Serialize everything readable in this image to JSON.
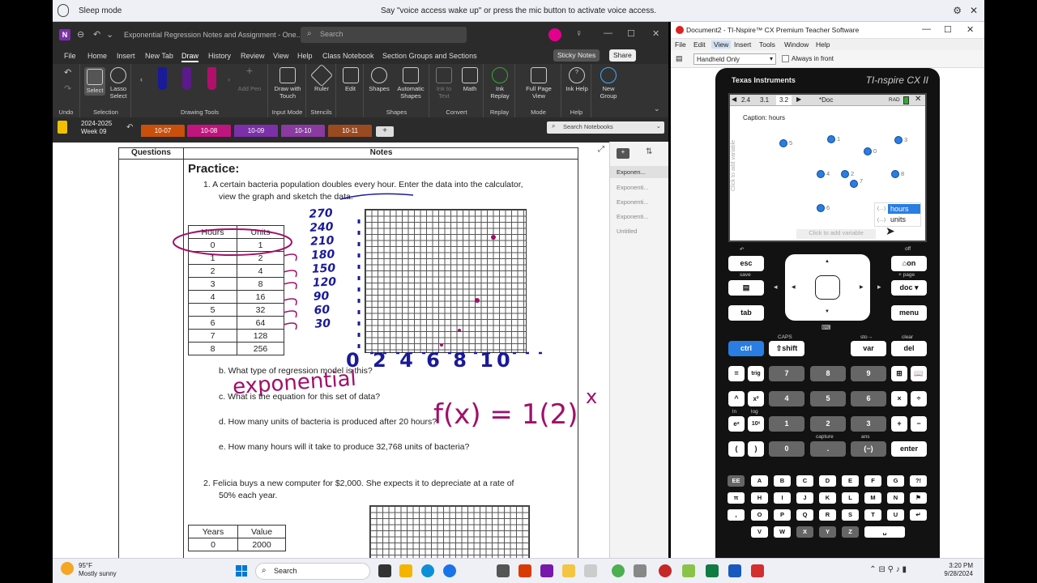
{
  "voice_bar": {
    "status": "Sleep mode",
    "message": "Say \"voice access wake up\" or press the mic button to activate voice access."
  },
  "onenote": {
    "window_title": "Exponential Regression Notes and Assignment  -  One...",
    "search_placeholder": "Search",
    "menu": [
      "File",
      "Home",
      "Insert",
      "New Tab",
      "Draw",
      "History",
      "Review",
      "View",
      "Help",
      "Class Notebook",
      "Section Groups and Sections"
    ],
    "active_menu": "Draw",
    "sticky_notes": "Sticky Notes",
    "share": "Share",
    "ribbon": {
      "undo_group": "Undo",
      "select": "Select",
      "lasso": "Lasso Select",
      "selection_group": "Selection",
      "add_pen": "Add Pen",
      "drawing_tools": "Drawing Tools",
      "draw_with_touch": "Draw with Touch",
      "input_mode": "Input Mode",
      "ruler": "Ruler",
      "stencils": "Stencils",
      "edit": "Edit",
      "shapes": "Shapes",
      "automatic_shapes": "Automatic Shapes",
      "shapes_group": "Shapes",
      "ink_to_text": "Ink to Text",
      "math": "Math",
      "convert_group": "Convert",
      "ink_replay": "Ink Replay",
      "replay_group": "Replay",
      "full_page_view": "Full Page View",
      "mode_group": "Mode",
      "ink_help": "Ink Help",
      "help_group": "Help",
      "new_group": "New Group"
    },
    "notebook": {
      "name": "2024-2025",
      "week": "Week 09"
    },
    "section_tabs": [
      {
        "label": "10-07",
        "color": "#c8500a",
        "text": "#fff"
      },
      {
        "label": "10-08",
        "color": "#c0157e",
        "text": "#fff"
      },
      {
        "label": "10-09",
        "color": "#7b2fa8",
        "text": "#fff"
      },
      {
        "label": "10-10",
        "color": "#8a3aa0",
        "text": "#fff"
      },
      {
        "label": "10-11",
        "color": "#9a4a20",
        "text": "#fff"
      }
    ],
    "search_notebooks": "Search Notebooks",
    "pages": [
      "Exponen...",
      "Exponenti...",
      "Exponenti...",
      "Exponenti...",
      "Untitled"
    ],
    "page": {
      "col_questions": "Questions",
      "col_notes": "Notes",
      "heading": "Practice:",
      "q1_line1": "1.    A certain bacteria population doubles every hour.  Enter the data into the calculator,",
      "q1_line2": "view the graph and sketch the data.",
      "table1_headers": [
        "Hours",
        "Units"
      ],
      "table1_rows": [
        [
          "0",
          "1"
        ],
        [
          "1",
          "2"
        ],
        [
          "2",
          "4"
        ],
        [
          "3",
          "8"
        ],
        [
          "4",
          "16"
        ],
        [
          "5",
          "32"
        ],
        [
          "6",
          "64"
        ],
        [
          "7",
          "128"
        ],
        [
          "8",
          "256"
        ]
      ],
      "qb": "b.   What type of regression model is this?",
      "qc": "c.   What is the equation for this set of data?",
      "qd": "d.   How many units of bacteria is produced after 20 hours?",
      "qe": "e.   How many hours will it take to produce 32,768 units of bacteria?",
      "q2_line1": "2.    Felicia buys a new computer for $2,000.  She expects it to depreciate at a rate of",
      "q2_line2": "50% each year.",
      "table2_headers": [
        "Years",
        "Value"
      ],
      "table2_rows": [
        [
          "0",
          "2000"
        ]
      ],
      "ink_answer": "exponential",
      "ink_equation": "f(x) = 1(2)",
      "ink_exponent": "x",
      "ink_y_labels": [
        "270",
        "240",
        "210",
        "180",
        "150",
        "120",
        "90",
        "60",
        "30"
      ],
      "ink_x_labels": "0  2  4  6  8  10"
    }
  },
  "nspire": {
    "window_title": "Document2 - TI-Nspire™ CX Premium Teacher Software",
    "menu": [
      "File",
      "Edit",
      "View",
      "Insert",
      "Tools",
      "Window",
      "Help"
    ],
    "view_mode": "Handheld Only",
    "always_in_front": "Always in front",
    "brand": "Texas Instruments",
    "model": "TI-nspire CX II",
    "tabs": [
      "2.4",
      "3.1",
      "3.2"
    ],
    "doc_label": "*Doc",
    "rad": "RAD",
    "caption": "Caption: hours",
    "add_variable_v": "Click to add variable",
    "add_variable_h": "Click to add variable",
    "var_options": [
      "hours",
      "units"
    ],
    "point_labels": [
      "5",
      "1",
      "0",
      "3",
      "4",
      "2",
      "7",
      "8",
      "6"
    ],
    "keys": {
      "esc": "esc",
      "on": "on",
      "save": "save",
      "off": "off",
      "page": "+ page",
      "doc": "doc",
      "tab": "tab",
      "menu": "menu",
      "caps": "CAPS",
      "sto": "sto→",
      "clear": "clear",
      "ctrl": "ctrl",
      "shift": "shift",
      "var": "var",
      "del": "del",
      "num": [
        "7",
        "8",
        "9",
        "4",
        "5",
        "6",
        "1",
        "2",
        "3",
        "0",
        ".",
        "(−)"
      ],
      "enter": "enter",
      "ex": "eˣ",
      "tenx": "10ˣ",
      "ln": "ln",
      "log": "log",
      "x2": "x²",
      "trig": "trig",
      "capture": "capture",
      "ans": "ans",
      "alpha1": [
        "EE",
        "A",
        "B",
        "C",
        "D",
        "E",
        "F",
        "G",
        "?!"
      ],
      "alpha2": [
        "π",
        "H",
        "I",
        "J",
        "K",
        "L",
        "M",
        "N",
        ""
      ],
      "alpha3": [
        ",",
        "O",
        "P",
        "Q",
        "R",
        "S",
        "T",
        "U",
        "↵"
      ],
      "alpha4": [
        "V",
        "W",
        "X",
        "Y",
        "Z",
        "␣"
      ]
    }
  },
  "taskbar": {
    "temperature": "95°F",
    "weather": "Mostly sunny",
    "search": "Search",
    "time": "3:20 PM",
    "date": "9/28/2024"
  }
}
